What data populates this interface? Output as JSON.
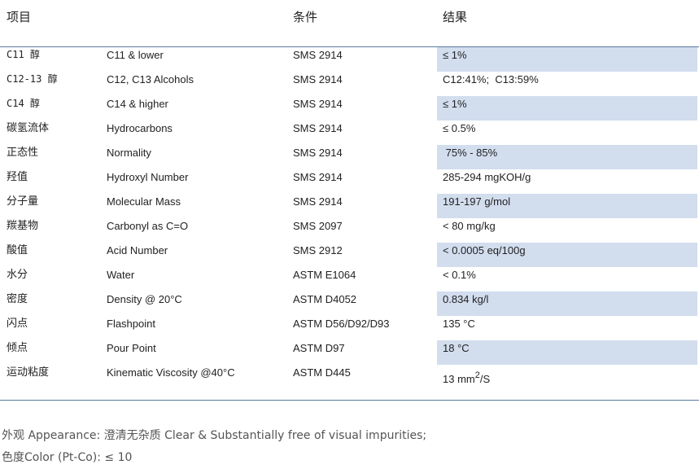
{
  "table": {
    "headers": [
      "项目",
      "条件",
      "结果"
    ],
    "rows": [
      {
        "cn": "C11 醇",
        "en": "C11 & lower",
        "method": "SMS 2914",
        "result": "≤ 1%",
        "shade": true,
        "font": "mono"
      },
      {
        "cn": "C12-13 醇",
        "en": "C12, C13 Alcohols",
        "method": "SMS 2914",
        "result": "C12:41%;  C13:59%",
        "shade": false,
        "font": "mono"
      },
      {
        "cn": "C14 醇",
        "en": "C14 & higher",
        "method": "SMS 2914",
        "result": "≤ 1%",
        "shade": true,
        "font": "mono"
      },
      {
        "cn": "碳氢流体",
        "en": "Hydrocarbons",
        "method": "SMS 2914",
        "result": "≤ 0.5%",
        "shade": false,
        "font": "cjk"
      },
      {
        "cn": "正态性",
        "en": "Normality",
        "method": "SMS 2914",
        "result": " 75% - 85%",
        "shade": true,
        "font": "cjk"
      },
      {
        "cn": "羟值",
        "en": "Hydroxyl Number",
        "method": "SMS 2914",
        "result": "285-294 mgKOH/g",
        "shade": false,
        "font": "cjk"
      },
      {
        "cn": "分子量",
        "en": "Molecular Mass",
        "method": "SMS 2914",
        "result": "191-197 g/mol",
        "shade": true,
        "font": "cjk"
      },
      {
        "cn": "羰基物",
        "en": "Carbonyl as C=O",
        "method": "SMS 2097",
        "result": "< 80 mg/kg",
        "shade": false,
        "font": "cjk"
      },
      {
        "cn": "酸值",
        "en": "Acid Number",
        "method": "SMS 2912",
        "result": "< 0.0005 eq/100g",
        "shade": true,
        "font": "cjk"
      },
      {
        "cn": "水分",
        "en": "Water",
        "method": "ASTM E1064",
        "result": "< 0.1%",
        "shade": false,
        "font": "cjk"
      },
      {
        "cn": "密度",
        "en": "Density @ 20°C",
        "method": "ASTM D4052",
        "result": "0.834 kg/l",
        "shade": true,
        "font": "cjk"
      },
      {
        "cn": "闪点",
        "en": "Flashpoint",
        "method": "ASTM D56/D92/D93",
        "result": "135 °C",
        "shade": false,
        "font": "cjk"
      },
      {
        "cn": "倾点",
        "en": "Pour Point",
        "method": "ASTM D97",
        "result": "18 °C",
        "shade": true,
        "font": "cjk"
      },
      {
        "cn": "运动粘度",
        "en": "Kinematic Viscosity @40°C",
        "method": "ASTM D445",
        "result": "13 mm",
        "result_sup": "2",
        "result_tail": "/S",
        "shade": false,
        "font": "cjk"
      }
    ]
  },
  "notes": {
    "appearance": "外观 Appearance: 澄清无杂质 Clear & Substantially free of visual impurities;",
    "color": "色度Color (Pt-Co): ≤ 10"
  },
  "colors": {
    "row_highlight": "#d2ddee",
    "rule": "#5b7aa0"
  }
}
